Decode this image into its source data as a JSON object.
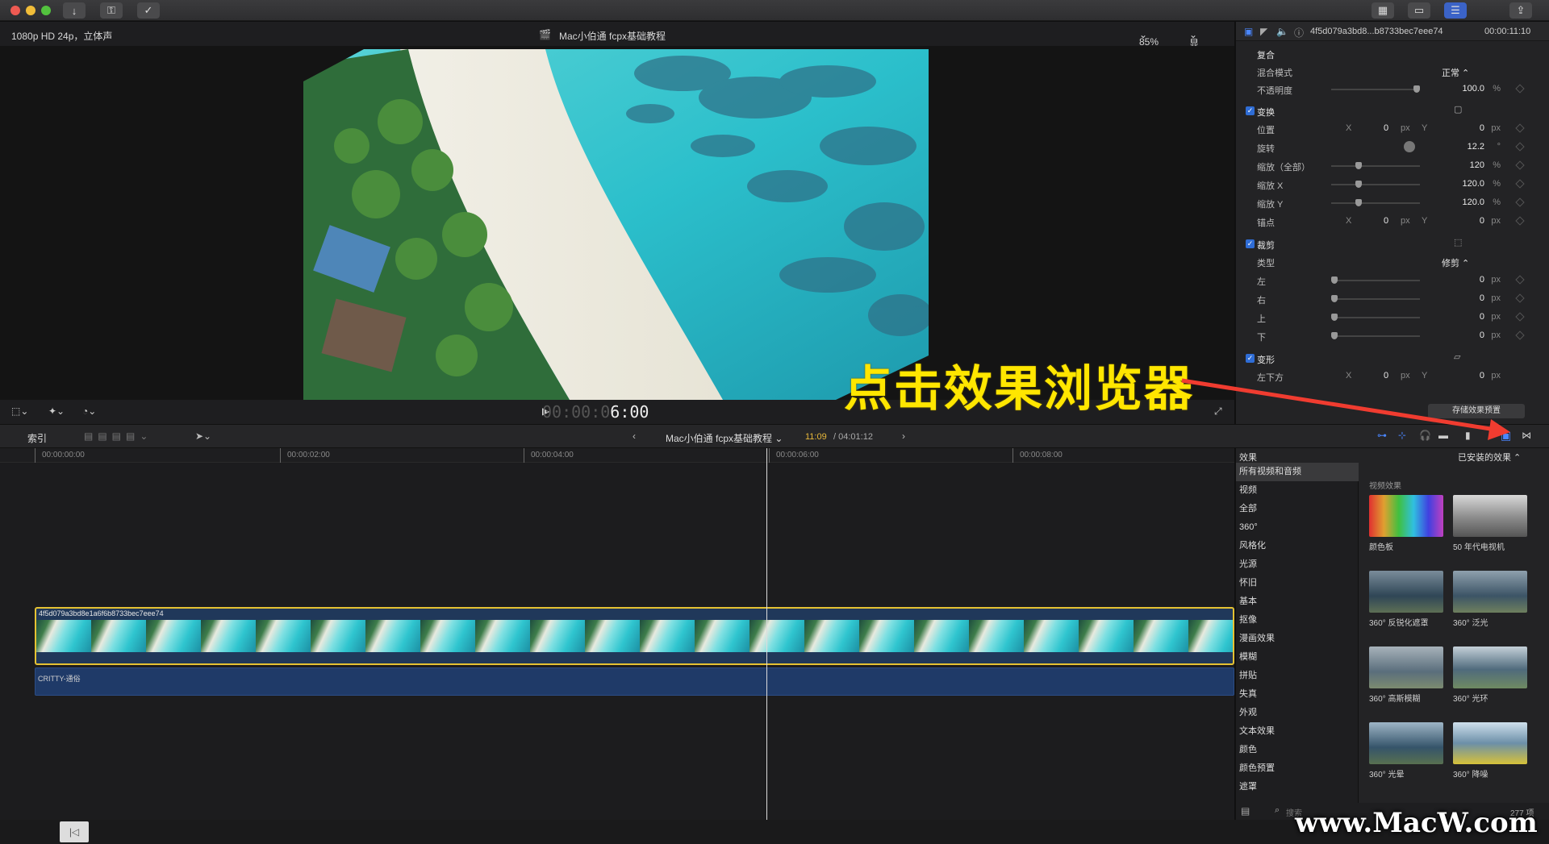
{
  "window": {
    "title": "Mac小伯通 fcpx基础教程"
  },
  "viewer": {
    "format": "1080p HD 24p，立体声",
    "project_title": "Mac小伯通 fcpx基础教程",
    "zoom": "85%",
    "display_menu": "显示",
    "timecode_dim": "00:00:0",
    "timecode_bright": "6:00"
  },
  "inspector": {
    "clip_name": "4f5d079a3bd8...b8733bec7eee74",
    "duration": "00:00:11:10",
    "composite": {
      "title": "复合",
      "blend_label": "混合模式",
      "blend_value": "正常",
      "opacity_label": "不透明度",
      "opacity_value": "100.0",
      "opacity_unit": "%",
      "opacity_level": 1.0
    },
    "transform": {
      "title": "变换",
      "position_label": "位置",
      "x": "X",
      "y": "Y",
      "px": "px",
      "position_x": "0",
      "position_y": "0",
      "rotation_label": "旋转",
      "rotation_value": "12.2",
      "rotation_unit": "°",
      "scale_all_label": "缩放（全部）",
      "scale_all_value": "120",
      "pct": "%",
      "scale_x_label": "缩放 X",
      "scale_x_value": "120.0",
      "scale_y_label": "缩放 Y",
      "scale_y_value": "120.0",
      "anchor_label": "锚点",
      "anchor_x": "0",
      "anchor_y": "0"
    },
    "crop": {
      "title": "裁剪",
      "type_label": "类型",
      "type_value": "修剪",
      "left_label": "左",
      "right_label": "右",
      "top_label": "上",
      "bottom_label": "下",
      "zero": "0"
    },
    "distort": {
      "title": "变形",
      "bl_label": "左下方",
      "bl_x": "0",
      "bl_y": "0"
    },
    "save_preset": "存储效果预置"
  },
  "timeline_toolbar": {
    "index": "索引",
    "project": "Mac小伯通 fcpx基础教程",
    "position": "11:09",
    "total": "/ 04:01:12"
  },
  "ruler": [
    "00:00:00:00",
    "00:00:02:00",
    "00:00:04:00",
    "00:00:06:00",
    "00:00:08:00"
  ],
  "timeline": {
    "clip_name": "4f5d079a3bd8e1a6f6b8733bec7eee74",
    "audio_name": "CRITTY-通俗"
  },
  "effects": {
    "title": "效果",
    "installed": "已安装的效果",
    "section": "视频效果",
    "categories": [
      "所有视频和音频",
      "视频",
      "全部",
      "360°",
      "风格化",
      "光源",
      "怀旧",
      "基本",
      "抠像",
      "漫画效果",
      "模糊",
      "拼贴",
      "失真",
      "外观",
      "文本效果",
      "颜色",
      "颜色预置",
      "遮罩"
    ],
    "items": [
      {
        "label": "颜色板"
      },
      {
        "label": "50 年代电视机"
      },
      {
        "label": "360° 反锐化遮罩"
      },
      {
        "label": "360° 泛光"
      },
      {
        "label": "360° 高斯模糊"
      },
      {
        "label": "360° 光环"
      },
      {
        "label": "360° 光晕"
      },
      {
        "label": "360° 降噪"
      }
    ],
    "search_placeholder": "搜索",
    "count": "277 项"
  },
  "annotation": "点击效果浏览器",
  "watermark": "www.MacW.com"
}
